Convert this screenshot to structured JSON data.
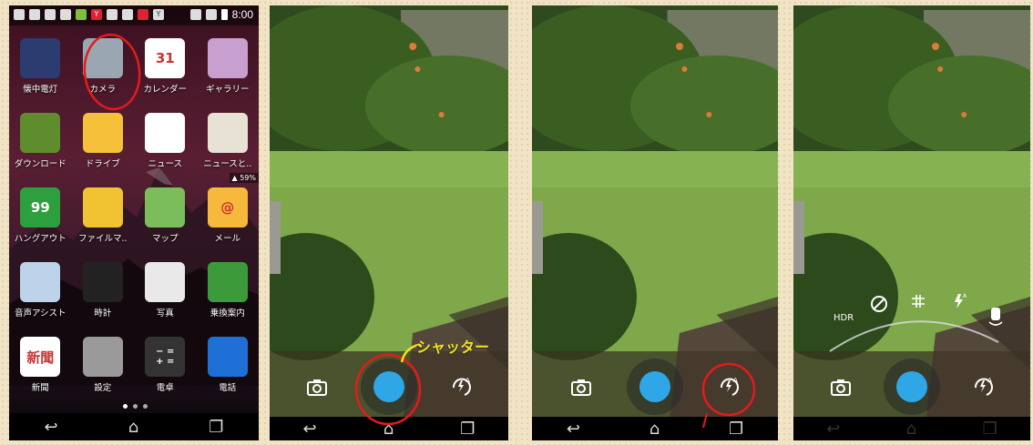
{
  "home": {
    "status_time": "8:00",
    "battery_chip": "59%",
    "apps": [
      {
        "label": "懐中電灯",
        "icon": "flashlight-icon",
        "color": "#2b3c70"
      },
      {
        "label": "カメラ",
        "icon": "camera-icon",
        "color": "#9aa7b3"
      },
      {
        "label": "カレンダー",
        "icon": "calendar-icon",
        "color": "#ffffff",
        "glyph": "31"
      },
      {
        "label": "ギャラリー",
        "icon": "gallery-icon",
        "color": "#c8a0d0"
      },
      {
        "label": "ダウンロード",
        "icon": "download-icon",
        "color": "#5f8d2e"
      },
      {
        "label": "ドライブ",
        "icon": "drive-icon",
        "color": "#f5c13a"
      },
      {
        "label": "ニュース",
        "icon": "yahoo-news-icon",
        "color": "#ffffff"
      },
      {
        "label": "ニュースと..",
        "icon": "google-news-icon",
        "color": "#e8e2d4"
      },
      {
        "label": "ハングアウト",
        "icon": "hangouts-icon",
        "color": "#2e9f3e",
        "glyph": "99"
      },
      {
        "label": "ファイルマ..",
        "icon": "file-manager-icon",
        "color": "#f1c232"
      },
      {
        "label": "マップ",
        "icon": "maps-icon",
        "color": "#7bbd5a"
      },
      {
        "label": "メール",
        "icon": "mail-icon",
        "color": "#f6b93b",
        "glyph": "@"
      },
      {
        "label": "音声アシスト",
        "icon": "voice-assist-icon",
        "color": "#bcd3ea"
      },
      {
        "label": "時計",
        "icon": "clock-icon",
        "color": "#222222"
      },
      {
        "label": "写真",
        "icon": "photos-icon",
        "color": "#e9e9e9"
      },
      {
        "label": "乗換案内",
        "icon": "transit-icon",
        "color": "#3d9a3a"
      },
      {
        "label": "新聞",
        "icon": "newspaper-icon",
        "color": "#ffffff",
        "glyph": "新聞"
      },
      {
        "label": "設定",
        "icon": "settings-gear-icon",
        "color": "#9a9a9a"
      },
      {
        "label": "電卓",
        "icon": "calculator-icon",
        "color": "#333333",
        "glyph": "− =\n+ ="
      },
      {
        "label": "電話",
        "icon": "phone-icon",
        "color": "#1e6fd6"
      }
    ]
  },
  "camera": {
    "shutter_annotation": "シャッター",
    "settings_labels": [
      "HDR"
    ],
    "accent": "#2fa6e6",
    "highlight": "#e31b1b"
  }
}
